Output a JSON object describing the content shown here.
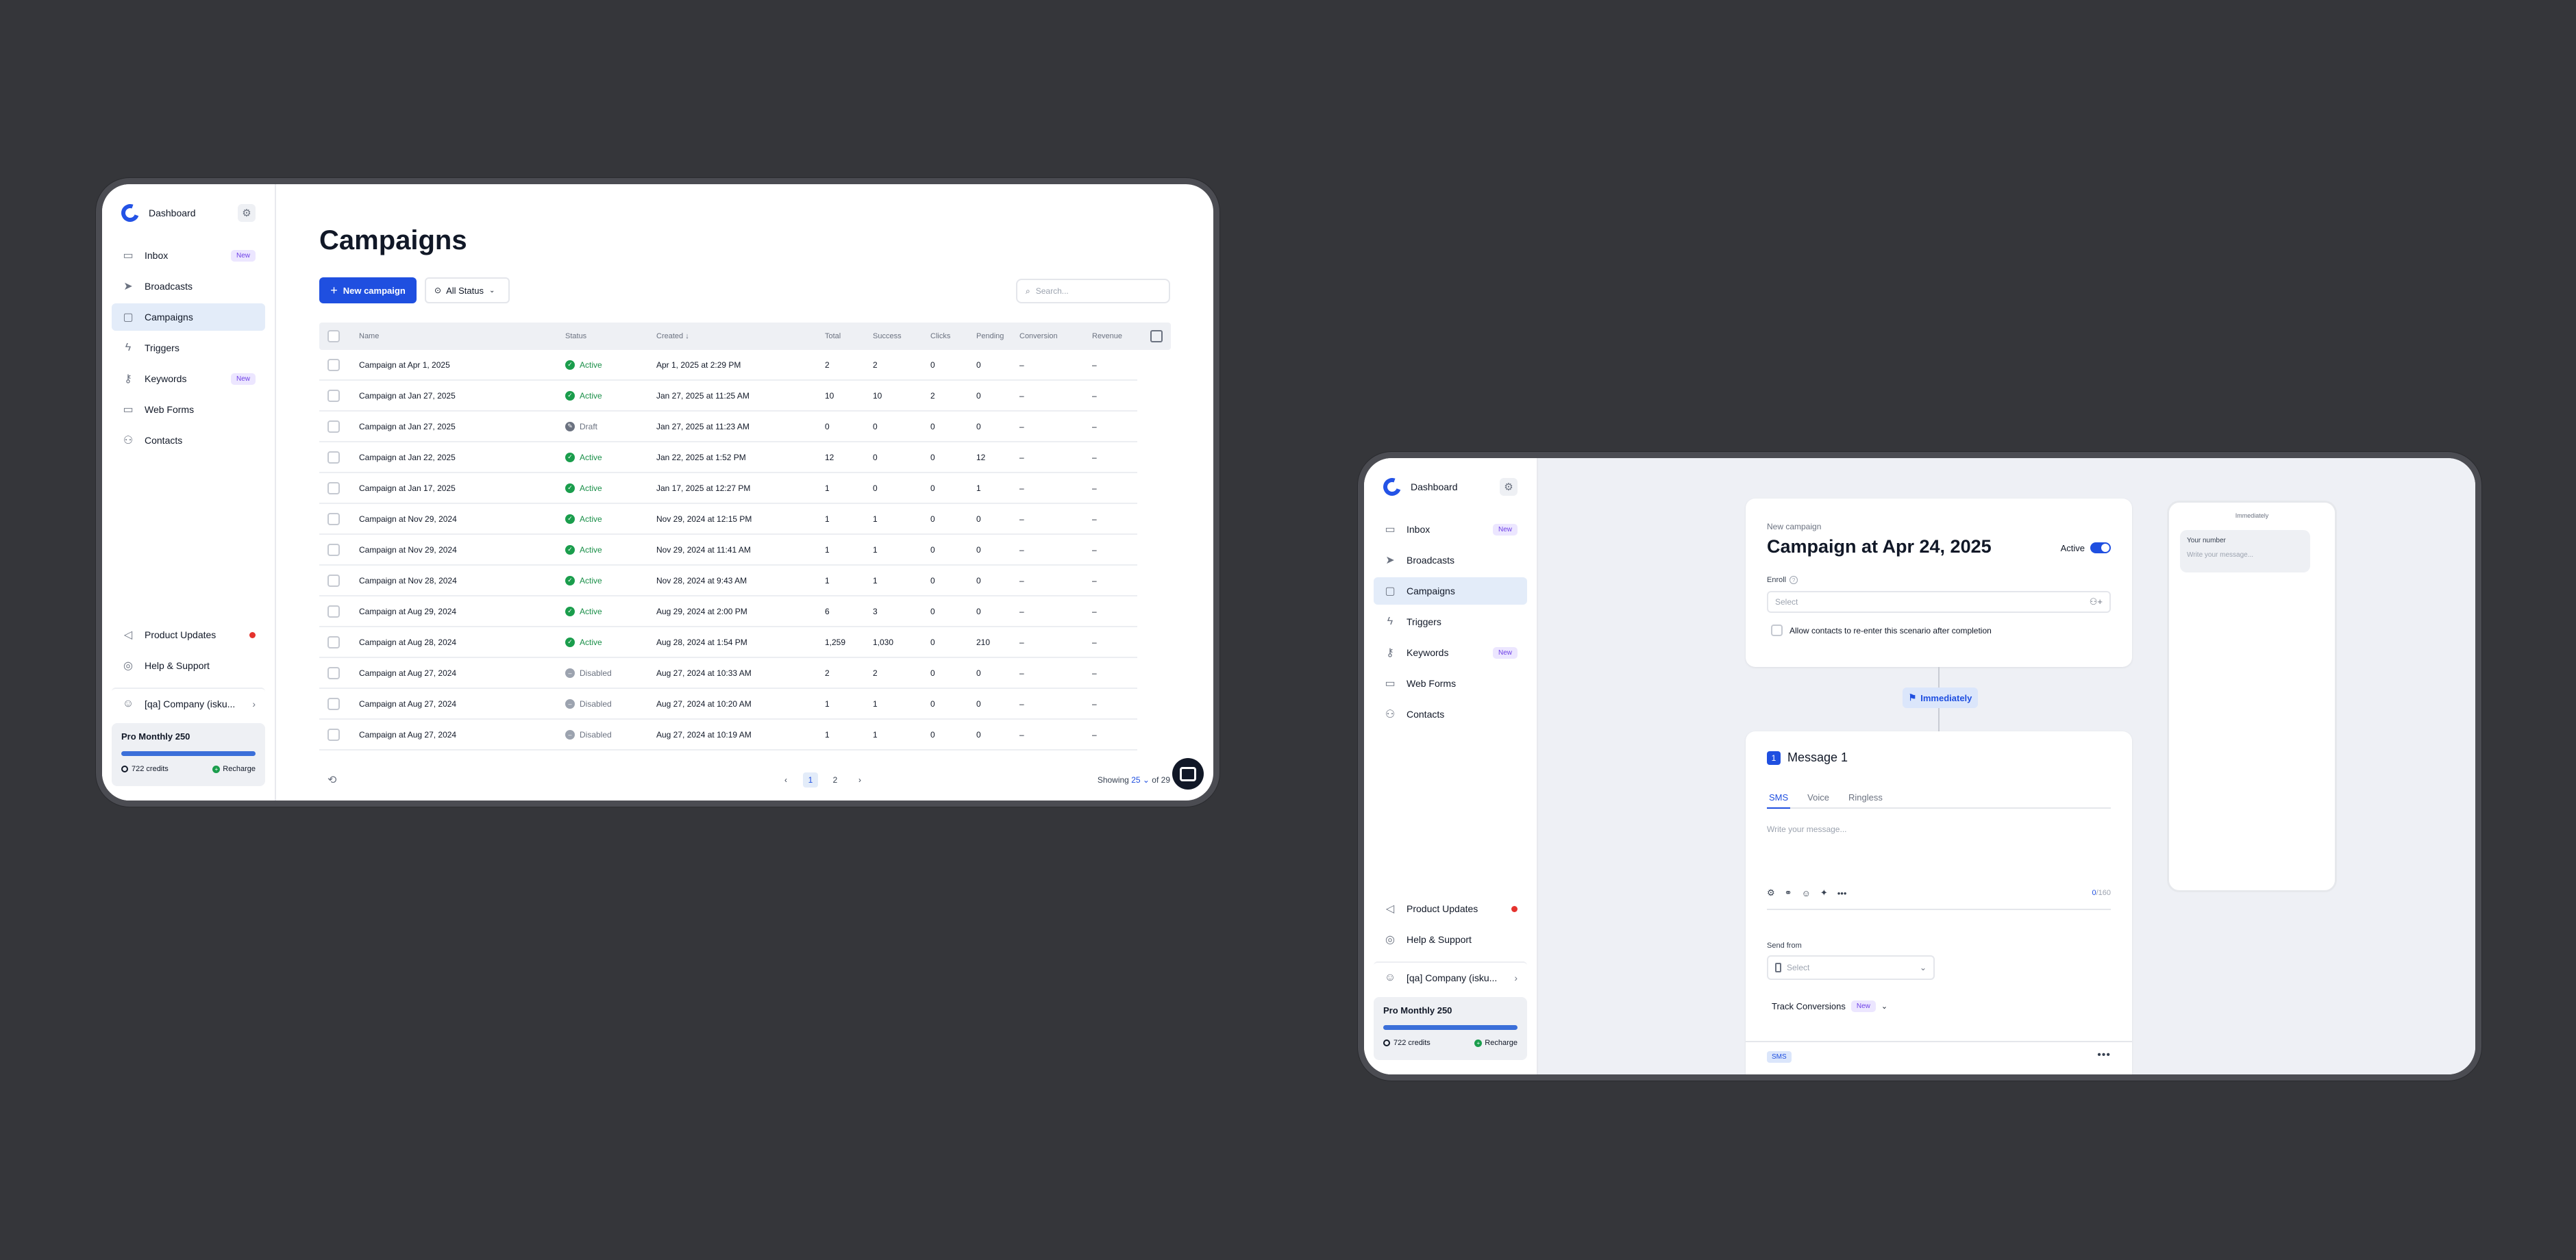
{
  "sidebar": {
    "title": "Dashboard",
    "items": [
      {
        "label": "Inbox",
        "badge": "New"
      },
      {
        "label": "Broadcasts"
      },
      {
        "label": "Campaigns"
      },
      {
        "label": "Triggers"
      },
      {
        "label": "Keywords",
        "badge": "New"
      },
      {
        "label": "Web Forms"
      },
      {
        "label": "Contacts"
      }
    ],
    "bottom": {
      "product_updates": "Product Updates",
      "help": "Help & Support",
      "company": "[qa] Company (isku..."
    },
    "plan": {
      "name": "Pro Monthly 250",
      "credits": "722 credits",
      "recharge": "Recharge",
      "usage_fraction": 1.0
    }
  },
  "campaigns": {
    "title": "Campaigns",
    "new_button": "New campaign",
    "filter": "All Status",
    "search_placeholder": "Search...",
    "columns": [
      "Name",
      "Status",
      "Created ↓",
      "Total",
      "Success",
      "Clicks",
      "Pending",
      "Conversion",
      "Revenue"
    ],
    "rows": [
      [
        "Campaign at Apr 1, 2025",
        "Active",
        "Apr 1, 2025 at 2:29 PM",
        "2",
        "2",
        "0",
        "0",
        "–",
        "–"
      ],
      [
        "Campaign at Jan 27, 2025",
        "Active",
        "Jan 27, 2025 at 11:25 AM",
        "10",
        "10",
        "2",
        "0",
        "–",
        "–"
      ],
      [
        "Campaign at Jan 27, 2025",
        "Draft",
        "Jan 27, 2025 at 11:23 AM",
        "0",
        "0",
        "0",
        "0",
        "–",
        "–"
      ],
      [
        "Campaign at Jan 22, 2025",
        "Active",
        "Jan 22, 2025 at 1:52 PM",
        "12",
        "0",
        "0",
        "12",
        "–",
        "–"
      ],
      [
        "Campaign at Jan 17, 2025",
        "Active",
        "Jan 17, 2025 at 12:27 PM",
        "1",
        "0",
        "0",
        "1",
        "–",
        "–"
      ],
      [
        "Campaign at Nov 29, 2024",
        "Active",
        "Nov 29, 2024 at 12:15 PM",
        "1",
        "1",
        "0",
        "0",
        "–",
        "–"
      ],
      [
        "Campaign at Nov 29, 2024",
        "Active",
        "Nov 29, 2024 at 11:41 AM",
        "1",
        "1",
        "0",
        "0",
        "–",
        "–"
      ],
      [
        "Campaign at Nov 28, 2024",
        "Active",
        "Nov 28, 2024 at 9:43 AM",
        "1",
        "1",
        "0",
        "0",
        "–",
        "–"
      ],
      [
        "Campaign at Aug 29, 2024",
        "Active",
        "Aug 29, 2024 at 2:00 PM",
        "6",
        "3",
        "0",
        "0",
        "–",
        "–"
      ],
      [
        "Campaign at Aug 28, 2024",
        "Active",
        "Aug 28, 2024 at 1:54 PM",
        "1,259",
        "1,030",
        "0",
        "210",
        "–",
        "–"
      ],
      [
        "Campaign at Aug 27, 2024",
        "Disabled",
        "Aug 27, 2024 at 10:33 AM",
        "2",
        "2",
        "0",
        "0",
        "–",
        "–"
      ],
      [
        "Campaign at Aug 27, 2024",
        "Disabled",
        "Aug 27, 2024 at 10:20 AM",
        "1",
        "1",
        "0",
        "0",
        "–",
        "–"
      ],
      [
        "Campaign at Aug 27, 2024",
        "Disabled",
        "Aug 27, 2024 at 10:19 AM",
        "1",
        "1",
        "0",
        "0",
        "–",
        "–"
      ]
    ],
    "pages": [
      "1",
      "2"
    ],
    "showing_label": "Showing",
    "page_size": "25",
    "of_total": "of 29"
  },
  "editor": {
    "subtitle": "New campaign",
    "title": "Campaign at Apr 24, 2025",
    "active_label": "Active",
    "enroll_label": "Enroll",
    "enroll_placeholder": "Select",
    "reenter_label": "Allow contacts to re-enter this scenario after completion",
    "delay_label": "Immediately",
    "message_number": "1",
    "message_title": "Message 1",
    "tabs": [
      "SMS",
      "Voice",
      "Ringless"
    ],
    "message_placeholder": "Write your message...",
    "counter_used": "0",
    "counter_max": "/160",
    "send_from_label": "Send from",
    "send_from_placeholder": "Select",
    "track_label": "Track Conversions",
    "track_badge": "New",
    "footer_chip": "SMS",
    "footer_menu": "•••"
  },
  "preview": {
    "header": "Immediately",
    "your_number": "Your number",
    "placeholder": "Write your message..."
  },
  "colors": {
    "accent": "#1f4fe0",
    "active": "#1a9d4c",
    "badge_bg": "#ece6ff",
    "badge_text": "#6d3fe6",
    "background": "#35363a"
  }
}
